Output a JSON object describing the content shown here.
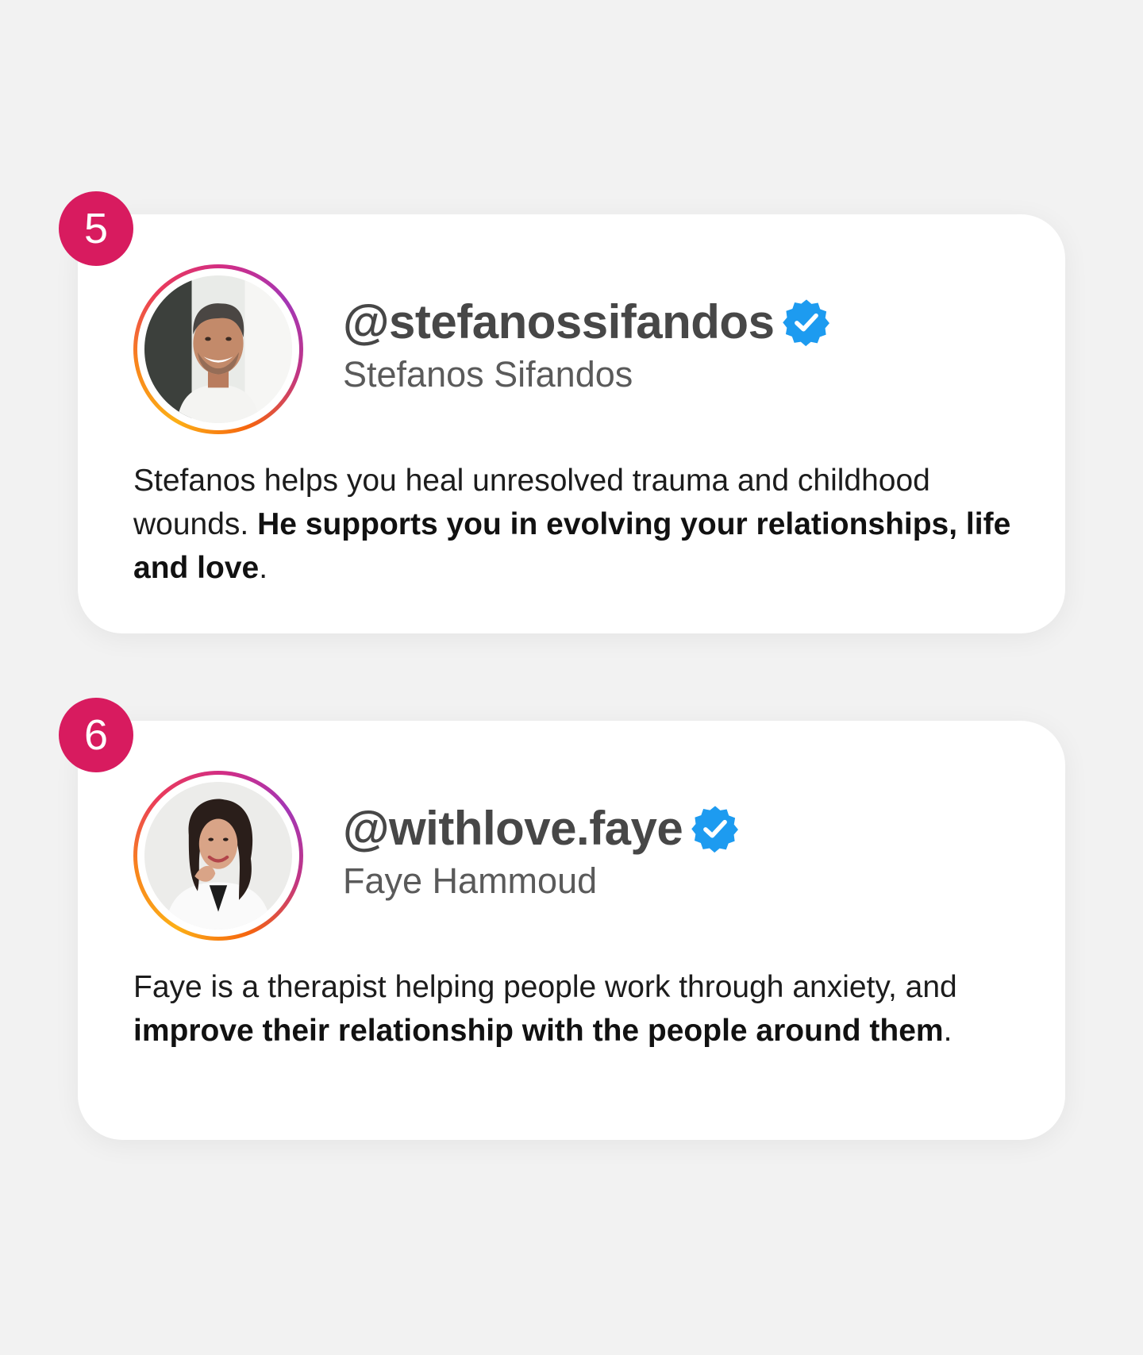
{
  "cards": [
    {
      "number": "5",
      "handle": "@stefanossifandos",
      "name": "Stefanos Sifandos",
      "desc_plain_1": "Stefanos helps you heal unresolved trauma and childhood wounds. ",
      "desc_bold": "He supports you in evolving your relationships, life and love",
      "desc_plain_2": "."
    },
    {
      "number": "6",
      "handle": "@withlove.faye",
      "name": "Faye Hammoud",
      "desc_plain_1": "Faye is a therapist helping people work through anxiety, and ",
      "desc_bold": "improve their relationship with the people around them",
      "desc_plain_2": "."
    }
  ],
  "colors": {
    "page_background": "#f2f2f2",
    "card_background": "#ffffff",
    "number_badge": "#d81b5f",
    "verified_badge": "#1d9bf0",
    "handle_text": "#474747",
    "name_text": "#5a5a5a"
  },
  "icons": {
    "verified": "verified-badge-icon",
    "avatar_ring": "instagram-story-ring"
  }
}
